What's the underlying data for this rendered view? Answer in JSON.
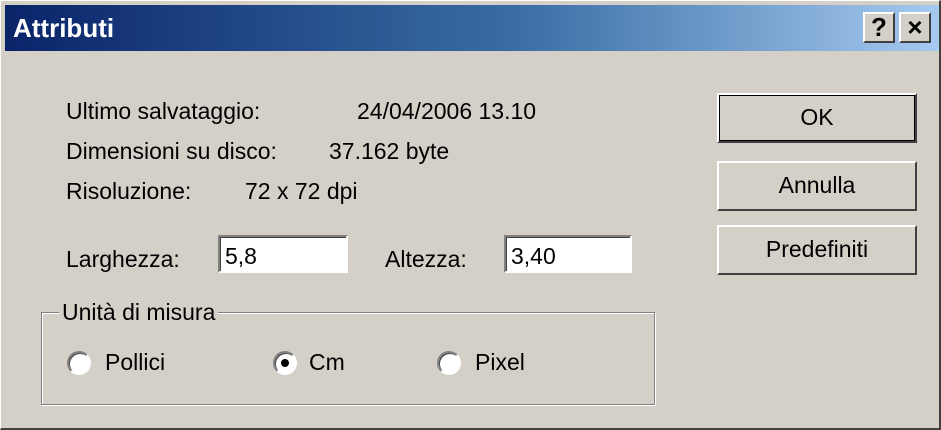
{
  "window": {
    "title": "Attributi",
    "help_button": "?",
    "close_button": "×"
  },
  "info": {
    "last_saved_label": "Ultimo salvataggio:",
    "last_saved_value": "24/04/2006 13.10",
    "disk_size_label": "Dimensioni su disco:",
    "disk_size_value": "37.162 byte",
    "resolution_label": "Risoluzione:",
    "resolution_value": "72 x 72 dpi"
  },
  "size": {
    "width_label": "Larghezza:",
    "width_value": "5,8",
    "height_label": "Altezza:",
    "height_value": "3,40"
  },
  "units": {
    "group_label": "Unità di misura",
    "options": [
      "Pollici",
      "Cm",
      "Pixel"
    ],
    "selected": "Cm"
  },
  "buttons": {
    "ok": "OK",
    "cancel": "Annulla",
    "defaults": "Predefiniti"
  }
}
